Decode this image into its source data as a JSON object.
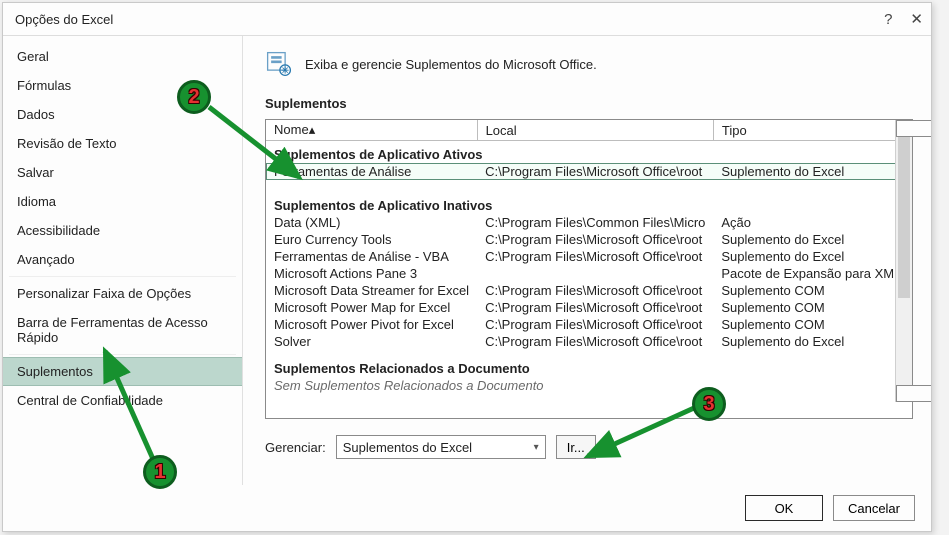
{
  "window": {
    "title": "Opções do Excel"
  },
  "sidebar": {
    "items": [
      {
        "label": "Geral"
      },
      {
        "label": "Fórmulas"
      },
      {
        "label": "Dados"
      },
      {
        "label": "Revisão de Texto"
      },
      {
        "label": "Salvar"
      },
      {
        "label": "Idioma"
      },
      {
        "label": "Acessibilidade"
      },
      {
        "label": "Avançado"
      },
      {
        "label": "Personalizar Faixa de Opções"
      },
      {
        "label": "Barra de Ferramentas de Acesso Rápido"
      },
      {
        "label": "Suplementos"
      },
      {
        "label": "Central de Confiabilidade"
      }
    ],
    "selected_index": 10
  },
  "intro_text": "Exiba e gerencie Suplementos do Microsoft Office.",
  "section_heading": "Suplementos",
  "columns": {
    "name": "Nome",
    "sort_indicator": "▴",
    "location": "Local",
    "type": "Tipo"
  },
  "groups": {
    "active": "Suplementos de Aplicativo Ativos",
    "inactive": "Suplementos de Aplicativo Inativos"
  },
  "addins": {
    "active": [
      {
        "name": "Ferramentas de Análise",
        "location": "C:\\Program Files\\Microsoft Office\\root",
        "type": "Suplemento do Excel"
      }
    ],
    "inactive": [
      {
        "name": "Data (XML)",
        "location": "C:\\Program Files\\Common Files\\Micro",
        "type": "Ação"
      },
      {
        "name": "Euro Currency Tools",
        "location": "C:\\Program Files\\Microsoft Office\\root",
        "type": "Suplemento do Excel"
      },
      {
        "name": "Ferramentas de Análise - VBA",
        "location": "C:\\Program Files\\Microsoft Office\\root",
        "type": "Suplemento do Excel"
      },
      {
        "name": "Microsoft Actions Pane 3",
        "location": "",
        "type": "Pacote de Expansão para XML"
      },
      {
        "name": "Microsoft Data Streamer for Excel",
        "location": "C:\\Program Files\\Microsoft Office\\root",
        "type": "Suplemento COM"
      },
      {
        "name": "Microsoft Power Map for Excel",
        "location": "C:\\Program Files\\Microsoft Office\\root",
        "type": "Suplemento COM"
      },
      {
        "name": "Microsoft Power Pivot for Excel",
        "location": "C:\\Program Files\\Microsoft Office\\root",
        "type": "Suplemento COM"
      },
      {
        "name": "Solver",
        "location": "C:\\Program Files\\Microsoft Office\\root",
        "type": "Suplemento do Excel"
      }
    ]
  },
  "doc_related": {
    "title": "Suplementos Relacionados a Documento",
    "empty": "Sem Suplementos Relacionados a Documento"
  },
  "manage": {
    "label": "Gerenciar:",
    "selected": "Suplementos do Excel",
    "go": "Ir..."
  },
  "footer": {
    "ok": "OK",
    "cancel": "Cancelar"
  },
  "annotations": {
    "b1": "1",
    "b2": "2",
    "b3": "3"
  }
}
